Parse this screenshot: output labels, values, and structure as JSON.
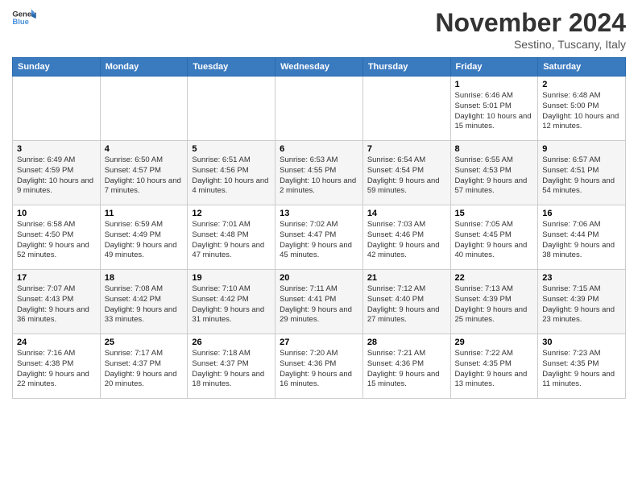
{
  "logo": {
    "line1": "General",
    "line2": "Blue"
  },
  "title": "November 2024",
  "subtitle": "Sestino, Tuscany, Italy",
  "days_header": [
    "Sunday",
    "Monday",
    "Tuesday",
    "Wednesday",
    "Thursday",
    "Friday",
    "Saturday"
  ],
  "weeks": [
    [
      {
        "day": "",
        "info": ""
      },
      {
        "day": "",
        "info": ""
      },
      {
        "day": "",
        "info": ""
      },
      {
        "day": "",
        "info": ""
      },
      {
        "day": "",
        "info": ""
      },
      {
        "day": "1",
        "info": "Sunrise: 6:46 AM\nSunset: 5:01 PM\nDaylight: 10 hours and 15 minutes."
      },
      {
        "day": "2",
        "info": "Sunrise: 6:48 AM\nSunset: 5:00 PM\nDaylight: 10 hours and 12 minutes."
      }
    ],
    [
      {
        "day": "3",
        "info": "Sunrise: 6:49 AM\nSunset: 4:59 PM\nDaylight: 10 hours and 9 minutes."
      },
      {
        "day": "4",
        "info": "Sunrise: 6:50 AM\nSunset: 4:57 PM\nDaylight: 10 hours and 7 minutes."
      },
      {
        "day": "5",
        "info": "Sunrise: 6:51 AM\nSunset: 4:56 PM\nDaylight: 10 hours and 4 minutes."
      },
      {
        "day": "6",
        "info": "Sunrise: 6:53 AM\nSunset: 4:55 PM\nDaylight: 10 hours and 2 minutes."
      },
      {
        "day": "7",
        "info": "Sunrise: 6:54 AM\nSunset: 4:54 PM\nDaylight: 9 hours and 59 minutes."
      },
      {
        "day": "8",
        "info": "Sunrise: 6:55 AM\nSunset: 4:53 PM\nDaylight: 9 hours and 57 minutes."
      },
      {
        "day": "9",
        "info": "Sunrise: 6:57 AM\nSunset: 4:51 PM\nDaylight: 9 hours and 54 minutes."
      }
    ],
    [
      {
        "day": "10",
        "info": "Sunrise: 6:58 AM\nSunset: 4:50 PM\nDaylight: 9 hours and 52 minutes."
      },
      {
        "day": "11",
        "info": "Sunrise: 6:59 AM\nSunset: 4:49 PM\nDaylight: 9 hours and 49 minutes."
      },
      {
        "day": "12",
        "info": "Sunrise: 7:01 AM\nSunset: 4:48 PM\nDaylight: 9 hours and 47 minutes."
      },
      {
        "day": "13",
        "info": "Sunrise: 7:02 AM\nSunset: 4:47 PM\nDaylight: 9 hours and 45 minutes."
      },
      {
        "day": "14",
        "info": "Sunrise: 7:03 AM\nSunset: 4:46 PM\nDaylight: 9 hours and 42 minutes."
      },
      {
        "day": "15",
        "info": "Sunrise: 7:05 AM\nSunset: 4:45 PM\nDaylight: 9 hours and 40 minutes."
      },
      {
        "day": "16",
        "info": "Sunrise: 7:06 AM\nSunset: 4:44 PM\nDaylight: 9 hours and 38 minutes."
      }
    ],
    [
      {
        "day": "17",
        "info": "Sunrise: 7:07 AM\nSunset: 4:43 PM\nDaylight: 9 hours and 36 minutes."
      },
      {
        "day": "18",
        "info": "Sunrise: 7:08 AM\nSunset: 4:42 PM\nDaylight: 9 hours and 33 minutes."
      },
      {
        "day": "19",
        "info": "Sunrise: 7:10 AM\nSunset: 4:42 PM\nDaylight: 9 hours and 31 minutes."
      },
      {
        "day": "20",
        "info": "Sunrise: 7:11 AM\nSunset: 4:41 PM\nDaylight: 9 hours and 29 minutes."
      },
      {
        "day": "21",
        "info": "Sunrise: 7:12 AM\nSunset: 4:40 PM\nDaylight: 9 hours and 27 minutes."
      },
      {
        "day": "22",
        "info": "Sunrise: 7:13 AM\nSunset: 4:39 PM\nDaylight: 9 hours and 25 minutes."
      },
      {
        "day": "23",
        "info": "Sunrise: 7:15 AM\nSunset: 4:39 PM\nDaylight: 9 hours and 23 minutes."
      }
    ],
    [
      {
        "day": "24",
        "info": "Sunrise: 7:16 AM\nSunset: 4:38 PM\nDaylight: 9 hours and 22 minutes."
      },
      {
        "day": "25",
        "info": "Sunrise: 7:17 AM\nSunset: 4:37 PM\nDaylight: 9 hours and 20 minutes."
      },
      {
        "day": "26",
        "info": "Sunrise: 7:18 AM\nSunset: 4:37 PM\nDaylight: 9 hours and 18 minutes."
      },
      {
        "day": "27",
        "info": "Sunrise: 7:20 AM\nSunset: 4:36 PM\nDaylight: 9 hours and 16 minutes."
      },
      {
        "day": "28",
        "info": "Sunrise: 7:21 AM\nSunset: 4:36 PM\nDaylight: 9 hours and 15 minutes."
      },
      {
        "day": "29",
        "info": "Sunrise: 7:22 AM\nSunset: 4:35 PM\nDaylight: 9 hours and 13 minutes."
      },
      {
        "day": "30",
        "info": "Sunrise: 7:23 AM\nSunset: 4:35 PM\nDaylight: 9 hours and 11 minutes."
      }
    ]
  ]
}
